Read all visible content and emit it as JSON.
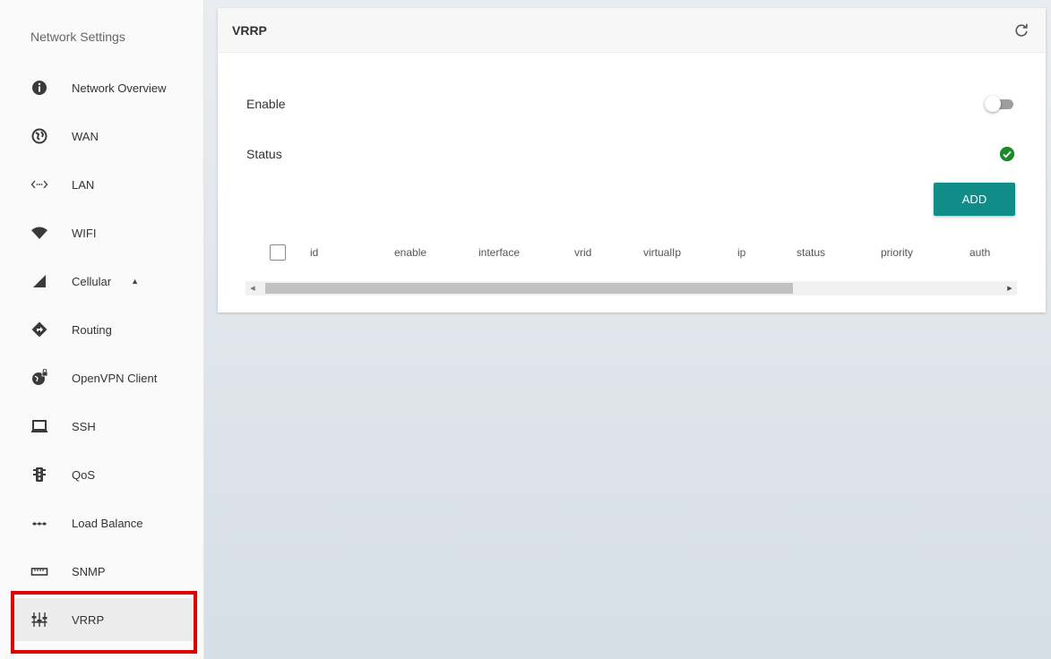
{
  "sidebar": {
    "title": "Network Settings",
    "items": [
      {
        "label": "Network Overview",
        "icon": "info-circle-icon"
      },
      {
        "label": "WAN",
        "icon": "globe-icon"
      },
      {
        "label": "LAN",
        "icon": "lan-dots-icon"
      },
      {
        "label": "WIFI",
        "icon": "wifi-icon"
      },
      {
        "label": "Cellular",
        "icon": "cellular-signal-icon"
      },
      {
        "label": "Routing",
        "icon": "directions-icon"
      },
      {
        "label": "OpenVPN Client",
        "icon": "vpn-globe-lock-icon"
      },
      {
        "label": "SSH",
        "icon": "laptop-icon"
      },
      {
        "label": "QoS",
        "icon": "traffic-light-icon"
      },
      {
        "label": "Load Balance",
        "icon": "dots-line-icon"
      },
      {
        "label": "SNMP",
        "icon": "ruler-icon"
      },
      {
        "label": "VRRP",
        "icon": "equalizer-icon"
      }
    ],
    "active": "VRRP"
  },
  "main": {
    "title": "VRRP",
    "enable_label": "Enable",
    "enable_value": false,
    "status_label": "Status",
    "status_value": "ok",
    "add_label": "ADD",
    "table_columns": [
      "id",
      "enable",
      "interface",
      "vrid",
      "virtualIp",
      "ip",
      "status",
      "priority",
      "auth"
    ]
  },
  "colors": {
    "accent": "#108d88",
    "status_ok": "#1b8a2a",
    "highlight": "#e10000"
  }
}
